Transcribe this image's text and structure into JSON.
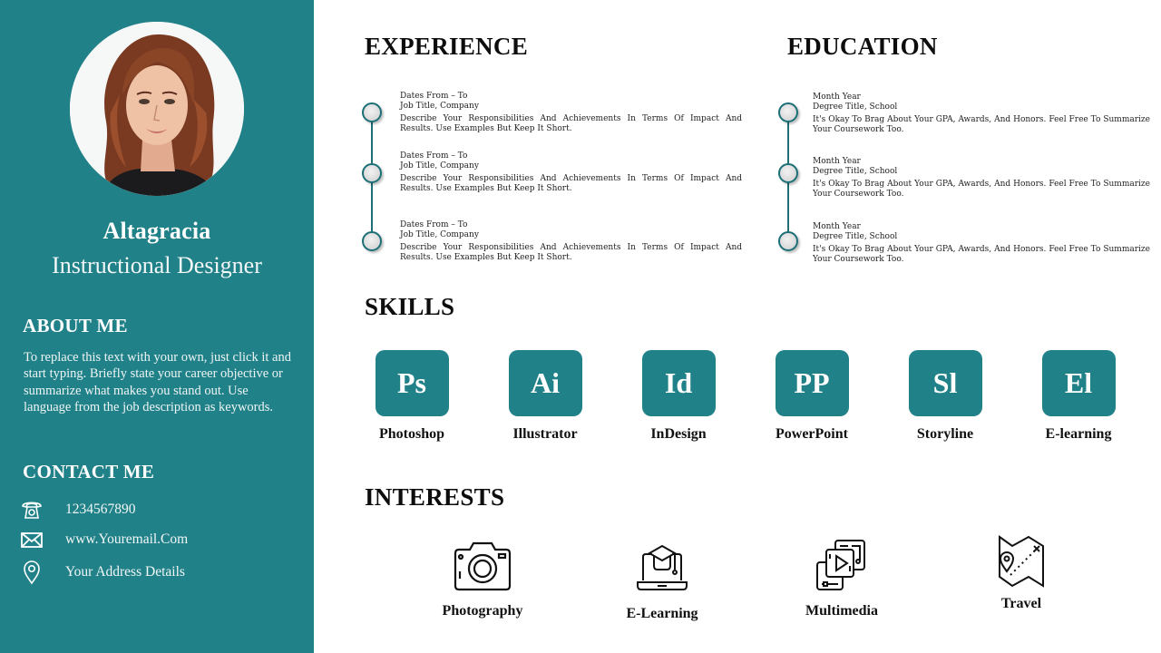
{
  "colors": {
    "accent": "#218188",
    "timeline": "#1c6f76",
    "text_dark": "#111111",
    "background": "#ffffff"
  },
  "profile": {
    "photo_alt": "portrait-photo",
    "name": "Altagracia",
    "role": "Instructional Designer"
  },
  "about": {
    "heading": "ABOUT ME",
    "text": "To replace this text with your own, just click it and start typing. Briefly state your career objective or summarize what makes you stand out. Use language from the job description as keywords."
  },
  "contact": {
    "heading": "CONTACT  ME",
    "items": [
      {
        "icon": "phone-icon",
        "text": "1234567890"
      },
      {
        "icon": "envelope-icon",
        "text": "www.Youremail.Com"
      },
      {
        "icon": "location-pin-icon",
        "text": "Your Address Details"
      }
    ]
  },
  "experience": {
    "heading": "EXPERIENCE",
    "entries": [
      {
        "dates": "Dates From  – To",
        "title": "Job Title, Company",
        "desc": "Describe Your Responsibilities  And Achievements  In Terms Of Impact And Results.  Use Examples But Keep It Short."
      },
      {
        "dates": "Dates From  – To",
        "title": "Job Title, Company",
        "desc": "Describe Your Responsibilities  And Achievements  In Terms Of Impact And Results.  Use Examples But Keep It Short."
      },
      {
        "dates": "Dates From  – To",
        "title": "Job Title, Company",
        "desc": "Describe Your Responsibilities  And Achievements  In Terms Of Impact And Results.  Use Examples But Keep It Short."
      }
    ]
  },
  "education": {
    "heading": "EDUCATION",
    "entries": [
      {
        "dates": "Month  Year",
        "title": "Degree Title, School",
        "desc": "It's Okay To Brag About  Your GPA, Awards, And Honors.  Feel Free To Summarize Your Coursework  Too."
      },
      {
        "dates": "Month  Year",
        "title": "Degree Title, School",
        "desc": "It's Okay To Brag About  Your GPA, Awards, And Honors.  Feel Free To Summarize Your Coursework  Too."
      },
      {
        "dates": "Month  Year",
        "title": "Degree Title, School",
        "desc": "It's Okay To Brag About  Your GPA, Awards, And Honors.  Feel Free To Summarize Your Coursework  Too."
      }
    ]
  },
  "skills": {
    "heading": "SKILLS",
    "items": [
      {
        "abbr": "Ps",
        "label": "Photoshop"
      },
      {
        "abbr": "Ai",
        "label": "Illustrator"
      },
      {
        "abbr": "Id",
        "label": "InDesign"
      },
      {
        "abbr": "PP",
        "label": "PowerPoint"
      },
      {
        "abbr": "Sl",
        "label": "Storyline"
      },
      {
        "abbr": "El",
        "label": "E-learning"
      }
    ]
  },
  "interests": {
    "heading": "INTERESTS",
    "items": [
      {
        "icon": "camera-icon",
        "label": "Photography"
      },
      {
        "icon": "laptop-graduation-cap-icon",
        "label": "E-Learning"
      },
      {
        "icon": "multimedia-icon",
        "label": "Multimedia"
      },
      {
        "icon": "map-icon",
        "label": "Travel"
      }
    ]
  }
}
